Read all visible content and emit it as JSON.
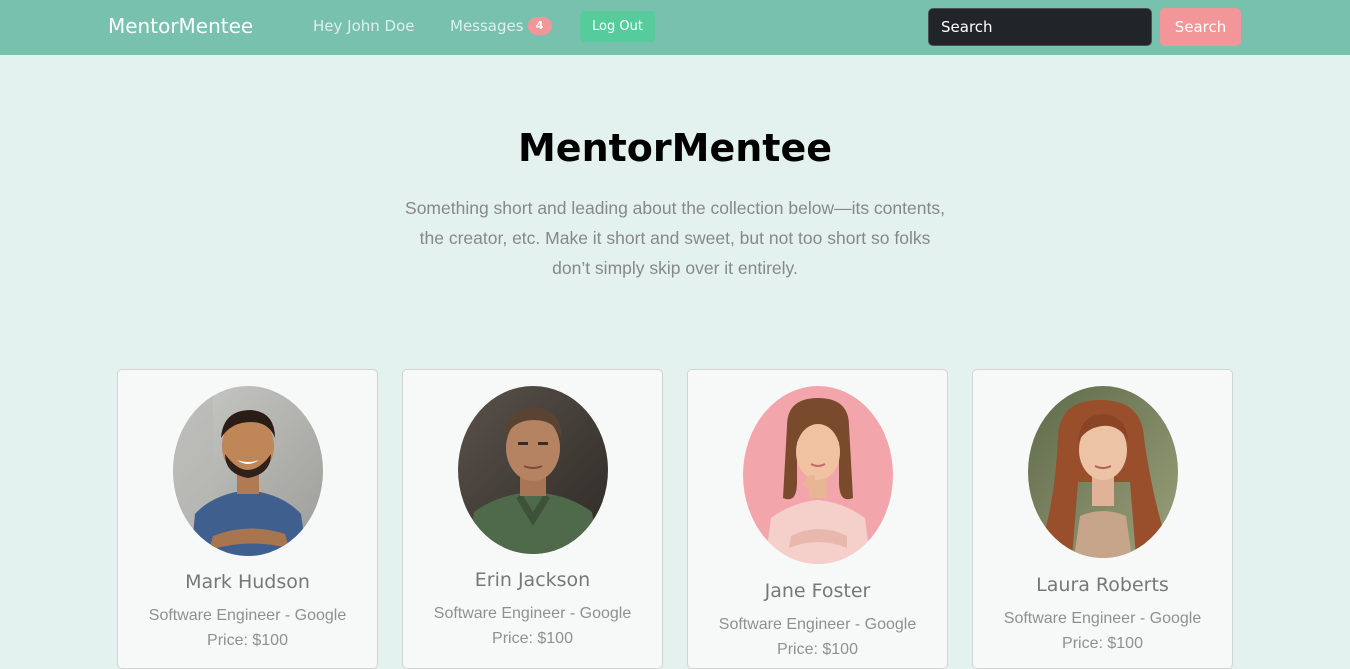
{
  "navbar": {
    "brand": "MentorMentee",
    "greeting": "Hey John Doe",
    "messages_label": "Messages",
    "messages_count": "4",
    "logout_label": "Log Out",
    "search_placeholder": "Search",
    "search_button": "Search",
    "bg_color": "#78c2ad"
  },
  "hero": {
    "title": "MentorMentee",
    "lead": "Something short and leading about the collection below—its contents, the creator, etc. Make it short and sweet, but not too short so folks don’t simply skip over it entirely."
  },
  "mentors": [
    {
      "name": "Mark Hudson",
      "role": "Software Engineer - Google",
      "price": "Price: $100",
      "photo": "man-smiling-blue-shirt-photo"
    },
    {
      "name": "Erin Jackson",
      "role": "Software Engineer - Google",
      "price": "Price: $100",
      "photo": "man-green-jacket-photo"
    },
    {
      "name": "Jane Foster",
      "role": "Software Engineer - Google",
      "price": "Price: $100",
      "photo": "woman-pink-background-photo"
    },
    {
      "name": "Laura Roberts",
      "role": "Software Engineer - Google",
      "price": "Price: $100",
      "photo": "woman-red-hair-photo"
    }
  ],
  "colors": {
    "primary": "#78c2ad",
    "success": "#56cc9d",
    "accent": "#f3969a",
    "page_bg": "#e3f2ee"
  }
}
